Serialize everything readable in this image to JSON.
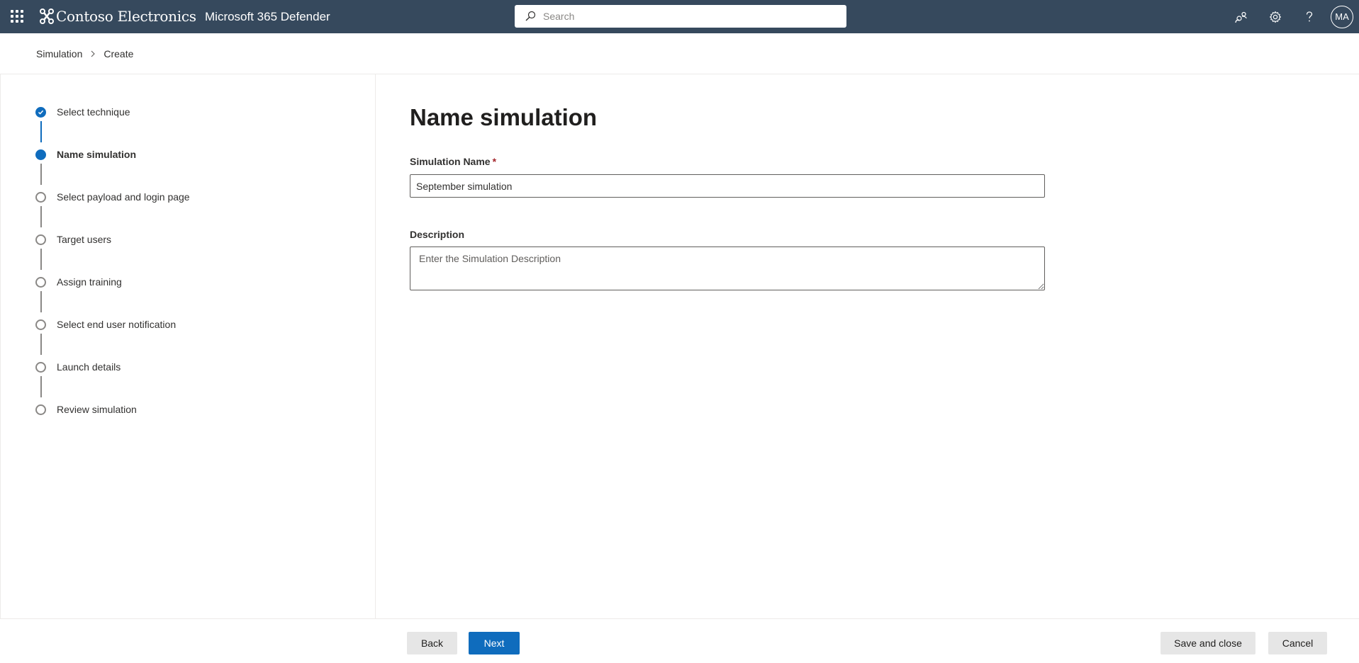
{
  "header": {
    "brand": "Contoso Electronics",
    "app_name": "Microsoft 365 Defender",
    "search_placeholder": "Search",
    "avatar_initials": "MA"
  },
  "breadcrumb": {
    "items": [
      "Simulation",
      "Create"
    ]
  },
  "steps": [
    {
      "label": "Select technique",
      "state": "done"
    },
    {
      "label": "Name simulation",
      "state": "current"
    },
    {
      "label": "Select payload and login page",
      "state": "pending"
    },
    {
      "label": "Target users",
      "state": "pending"
    },
    {
      "label": "Assign training",
      "state": "pending"
    },
    {
      "label": "Select end user notification",
      "state": "pending"
    },
    {
      "label": "Launch details",
      "state": "pending"
    },
    {
      "label": "Review simulation",
      "state": "pending"
    }
  ],
  "main": {
    "title": "Name simulation",
    "name_label": "Simulation Name",
    "required_marker": "*",
    "name_value": "September simulation",
    "description_label": "Description",
    "description_placeholder": "Enter the Simulation Description"
  },
  "footer": {
    "back_label": "Back",
    "next_label": "Next",
    "save_close_label": "Save and close",
    "cancel_label": "Cancel"
  },
  "colors": {
    "topbar": "#36495d",
    "accent": "#0f6cbd"
  }
}
